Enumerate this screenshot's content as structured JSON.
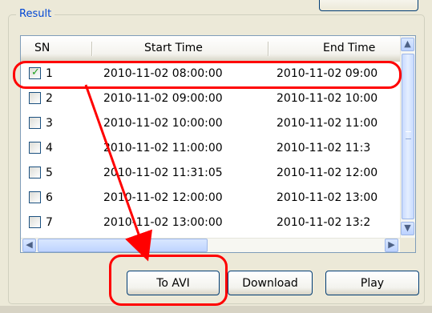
{
  "window": {
    "section_title": "Result"
  },
  "table": {
    "columns": [
      "SN",
      "Start Time",
      "End Time"
    ],
    "rows": [
      {
        "sn": "1",
        "start": "2010-11-02 08:00:00",
        "end": "2010-11-02 09:00",
        "checked": true
      },
      {
        "sn": "2",
        "start": "2010-11-02 09:00:00",
        "end": "2010-11-02 10:00",
        "checked": false
      },
      {
        "sn": "3",
        "start": "2010-11-02 10:00:00",
        "end": "2010-11-02 11:00",
        "checked": false
      },
      {
        "sn": "4",
        "start": "2010-11-02 11:00:00",
        "end": "2010-11-02 11:3",
        "checked": false
      },
      {
        "sn": "5",
        "start": "2010-11-02 11:31:05",
        "end": "2010-11-02 12:00",
        "checked": false
      },
      {
        "sn": "6",
        "start": "2010-11-02 12:00:00",
        "end": "2010-11-02 13:00",
        "checked": false
      },
      {
        "sn": "7",
        "start": "2010-11-02 13:00:00",
        "end": "2010-11-02 13:2",
        "checked": false
      }
    ]
  },
  "buttons": {
    "to_avi": "To AVI",
    "download": "Download",
    "play": "Play"
  },
  "icons": {
    "checkbox": "checkbox-icon",
    "scroll_up": "chevron-up-icon",
    "scroll_down": "chevron-down-icon",
    "scroll_left": "chevron-left-icon",
    "scroll_right": "chevron-right-icon",
    "annotation_arrow": "arrow-icon"
  },
  "colors": {
    "annotation": "#ff0000",
    "title": "#0046d5",
    "checkmark": "#21a121"
  }
}
